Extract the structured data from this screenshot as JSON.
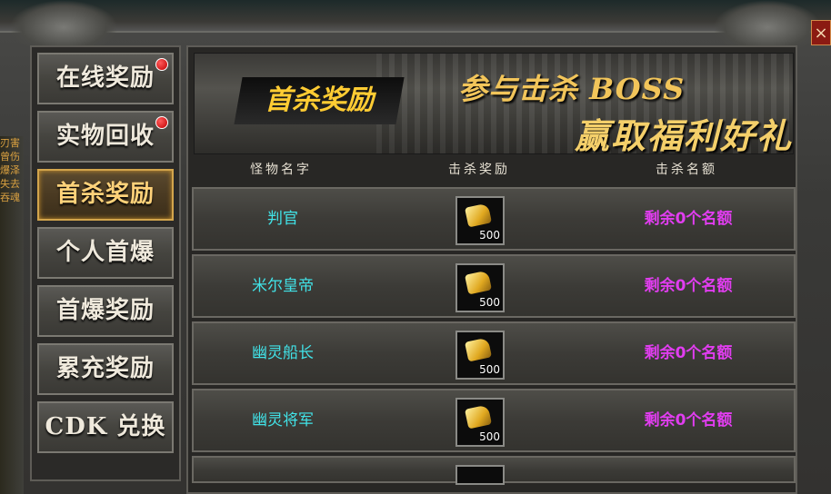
{
  "window": {
    "close_label": "×",
    "left_game_text": [
      "刃害",
      "曾伤",
      "爆泽",
      "失去",
      "吞魂"
    ]
  },
  "sidebar": {
    "items": [
      {
        "label": "在线奖励",
        "badge": true,
        "active": false
      },
      {
        "label": "实物回收",
        "badge": true,
        "active": false
      },
      {
        "label": "首杀奖励",
        "badge": false,
        "active": true
      },
      {
        "label": "个人首爆",
        "badge": false,
        "active": false
      },
      {
        "label": "首爆奖励",
        "badge": false,
        "active": false
      },
      {
        "label": "累充奖励",
        "badge": false,
        "active": false
      },
      {
        "label": "CDK 兑换",
        "badge": false,
        "active": false
      }
    ]
  },
  "banner": {
    "tag": "首杀奖励",
    "line1": "参与击杀 BOSS",
    "line2": "赢取福利好礼"
  },
  "table": {
    "headers": [
      "怪物名字",
      "击杀奖励",
      "击杀名额"
    ],
    "rows": [
      {
        "monster": "判官",
        "reward_qty": "500",
        "quota": "剩余0个名额"
      },
      {
        "monster": "米尔皇帝",
        "reward_qty": "500",
        "quota": "剩余0个名额"
      },
      {
        "monster": "幽灵船长",
        "reward_qty": "500",
        "quota": "剩余0个名额"
      },
      {
        "monster": "幽灵将军",
        "reward_qty": "500",
        "quota": "剩余0个名额"
      }
    ]
  },
  "colors": {
    "monster_name": "#41e3e8",
    "quota": "#e13df0",
    "active_tab": "#ffd27a"
  }
}
